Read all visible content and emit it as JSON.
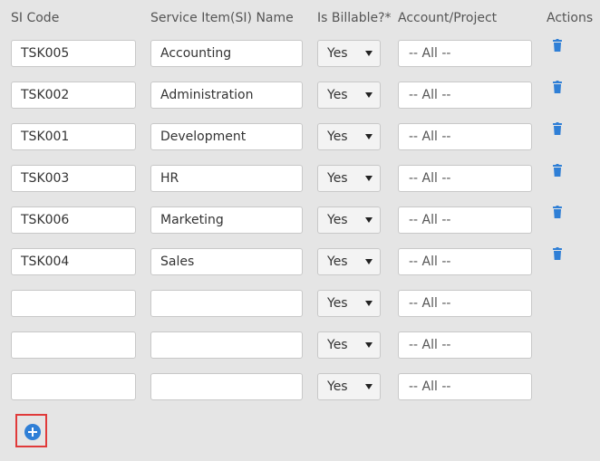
{
  "headers": {
    "code": "SI Code",
    "name": "Service Item(SI) Name",
    "billable": "Is Billable?*",
    "account": "Account/Project",
    "actions": "Actions"
  },
  "rows": [
    {
      "code": "TSK005",
      "name": "Accounting",
      "billable": "Yes",
      "account": "-- All --",
      "has_delete": true
    },
    {
      "code": "TSK002",
      "name": "Administration",
      "billable": "Yes",
      "account": "-- All --",
      "has_delete": true
    },
    {
      "code": "TSK001",
      "name": "Development",
      "billable": "Yes",
      "account": "-- All --",
      "has_delete": true
    },
    {
      "code": "TSK003",
      "name": "HR",
      "billable": "Yes",
      "account": "-- All --",
      "has_delete": true
    },
    {
      "code": "TSK006",
      "name": "Marketing",
      "billable": "Yes",
      "account": "-- All --",
      "has_delete": true
    },
    {
      "code": "TSK004",
      "name": "Sales",
      "billable": "Yes",
      "account": "-- All --",
      "has_delete": true
    },
    {
      "code": "",
      "name": "",
      "billable": "Yes",
      "account": "-- All --",
      "has_delete": false
    },
    {
      "code": "",
      "name": "",
      "billable": "Yes",
      "account": "-- All --",
      "has_delete": false
    },
    {
      "code": "",
      "name": "",
      "billable": "Yes",
      "account": "-- All --",
      "has_delete": false
    }
  ],
  "icons": {
    "delete": "trash-icon",
    "add": "plus-circle-icon"
  },
  "colors": {
    "accent": "#2f7fd6",
    "highlight": "#e03a3a"
  }
}
